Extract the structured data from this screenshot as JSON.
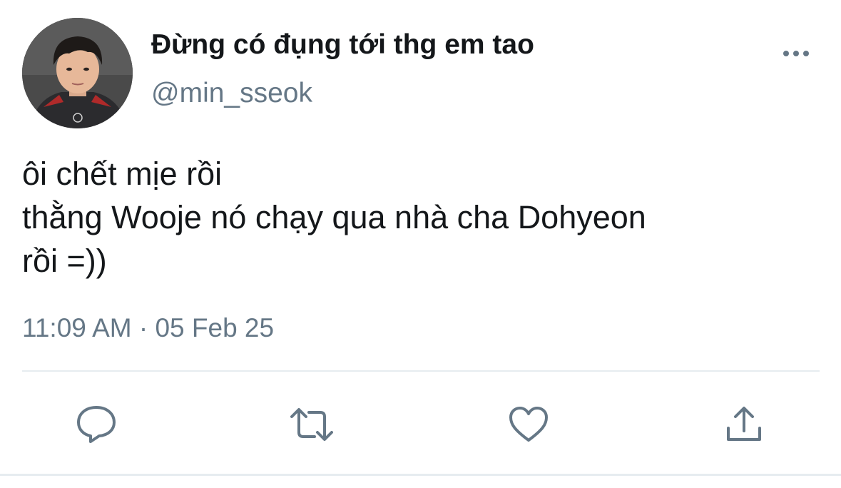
{
  "tweet": {
    "display_name": "Đừng có đụng tới thg em tao",
    "handle": "@min_sseok",
    "text_lines": [
      "ôi chết mịe rồi",
      "thằng Wooje nó chạy qua nhà cha Dohyeon",
      "rồi =))"
    ],
    "timestamp": "11:09 AM · 05 Feb 25"
  },
  "icons": {
    "more": "more-horizontal-icon",
    "reply": "reply-icon",
    "retweet": "retweet-icon",
    "like": "like-icon",
    "share": "share-icon"
  },
  "colors": {
    "text": "#14171a",
    "secondary": "#657786",
    "divider": "#e6ecf0"
  }
}
